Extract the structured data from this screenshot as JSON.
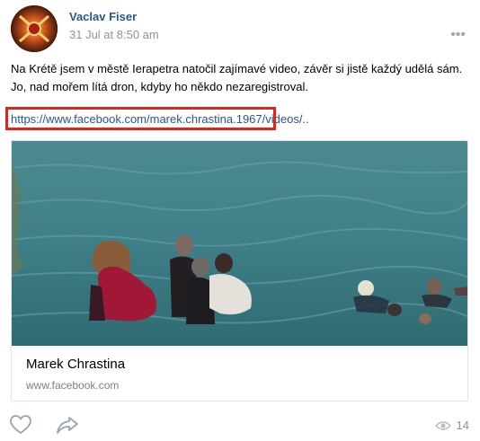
{
  "post": {
    "author": "Vaclav Fiser",
    "date": "31 Jul at 8:50 am",
    "text_line1": "Na Krétě jsem v městě Ierapetra natočil zajímavé video, závěr si jistě každý udělá sám.",
    "text_line2": "Jo, nad mořem lítá dron, kdyby ho někdo nezaregistroval.",
    "link": "https://www.facebook.com/marek.chrastina.1967/videos/..",
    "more_glyph": "•••"
  },
  "attachment": {
    "title": "Marek Chrastina",
    "domain": "www.facebook.com"
  },
  "footer": {
    "views": "14"
  },
  "colors": {
    "link": "#2a5885",
    "highlight": "#e0241b",
    "sea": "#3f7f87"
  }
}
